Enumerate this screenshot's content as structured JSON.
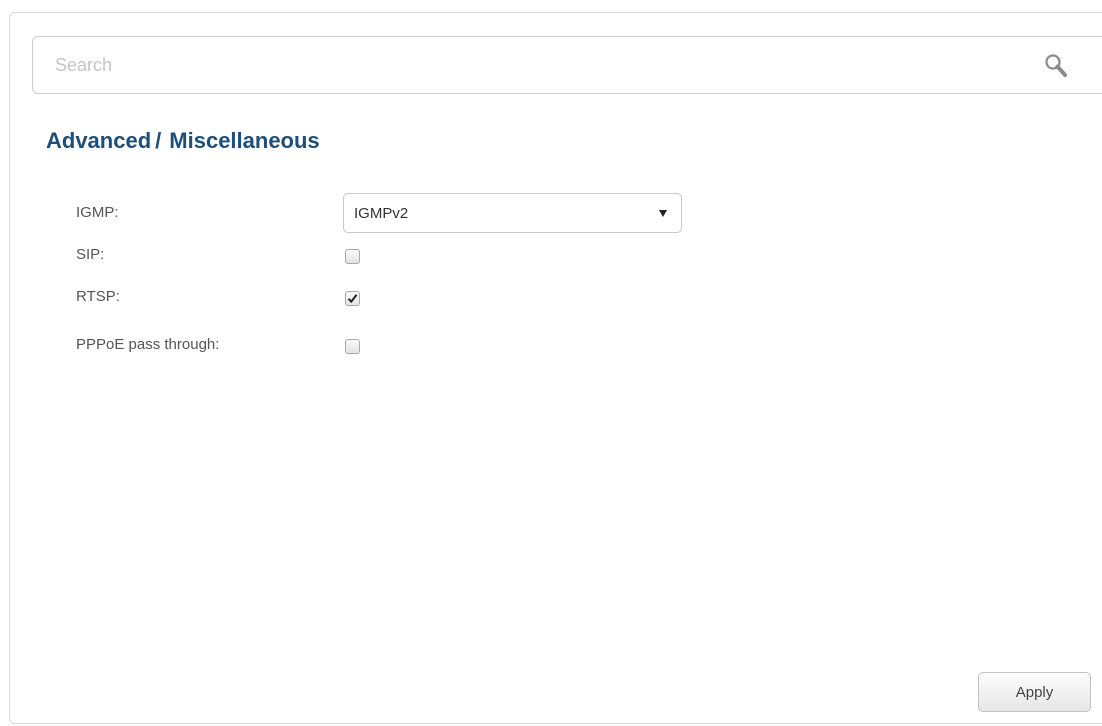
{
  "search": {
    "placeholder": "Search",
    "value": "",
    "icon": "search-icon"
  },
  "breadcrumb": {
    "section": "Advanced",
    "separator": "/",
    "page": "Miscellaneous"
  },
  "form": {
    "igmp": {
      "label": "IGMP:",
      "selected": "IGMPv2"
    },
    "sip": {
      "label": "SIP:",
      "checked": false
    },
    "rtsp": {
      "label": "RTSP:",
      "checked": true
    },
    "pppoe": {
      "label": "PPPoE pass through:",
      "checked": false
    }
  },
  "actions": {
    "apply_label": "Apply"
  },
  "colors": {
    "title": "#1e4f7a",
    "label": "#555555",
    "border": "#d9d9d9"
  }
}
